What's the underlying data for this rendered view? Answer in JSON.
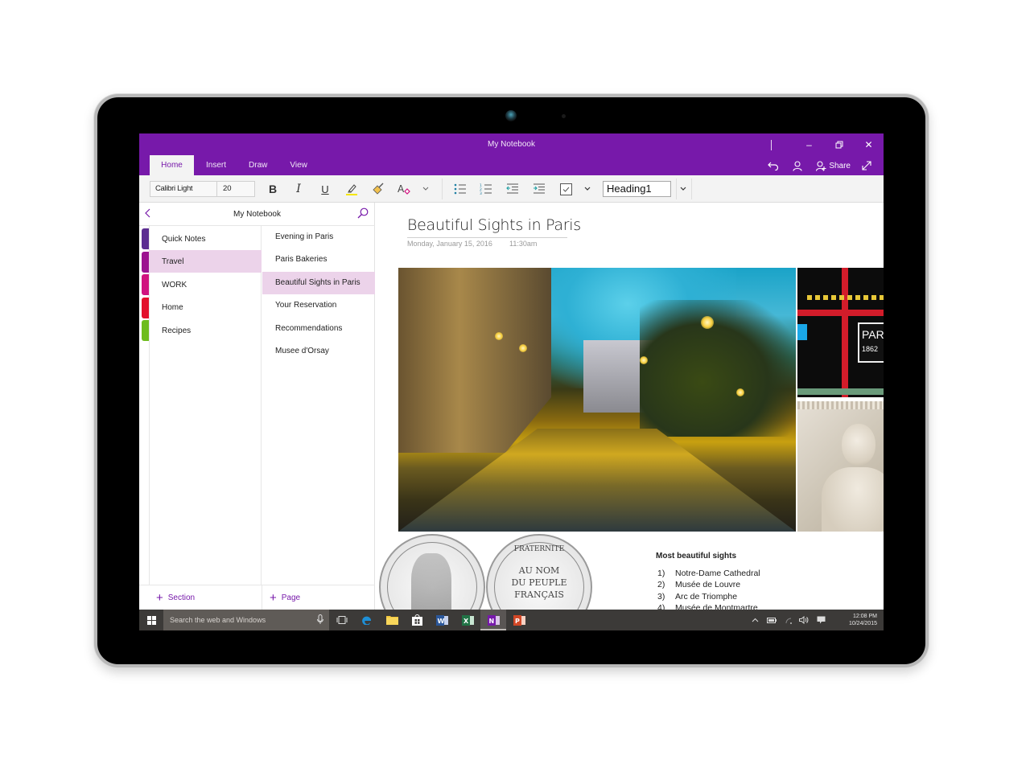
{
  "window": {
    "title": "My Notebook",
    "controls": {
      "minimize": "–",
      "restore": "❐",
      "close": "✕"
    }
  },
  "ribbon": {
    "tabs": [
      {
        "label": "Home",
        "active": true
      },
      {
        "label": "Insert",
        "active": false
      },
      {
        "label": "Draw",
        "active": false
      },
      {
        "label": "View",
        "active": false
      }
    ],
    "actions": {
      "share_label": "Share"
    },
    "font_name": "Calibri Light",
    "font_size": "20",
    "bold": "B",
    "italic": "I",
    "underline": "U",
    "style": "Heading1",
    "highlight_color": "#f5e600",
    "accent_color": "#7719aa"
  },
  "nav": {
    "title": "My Notebook",
    "sections": [
      {
        "label": "Quick Notes",
        "color": "#5c2d91",
        "active": false
      },
      {
        "label": "Travel",
        "color": "#9c1390",
        "active": true
      },
      {
        "label": "WORK",
        "color": "#d0137f",
        "active": false
      },
      {
        "label": "Home",
        "color": "#e3102c",
        "active": false
      },
      {
        "label": "Recipes",
        "color": "#6ebc1d",
        "active": false
      }
    ],
    "pages": [
      {
        "label": "Evening in Paris",
        "active": false
      },
      {
        "label": "Paris Bakeries",
        "active": false
      },
      {
        "label": "Beautiful Sights in Paris",
        "active": true
      },
      {
        "label": "Your Reservation",
        "active": false
      },
      {
        "label": "Recommendations",
        "active": false
      },
      {
        "label": "Musee d'Orsay",
        "active": false
      }
    ],
    "add_section": "Section",
    "add_page": "Page"
  },
  "page": {
    "title": "Beautiful Sights in Paris",
    "date": "Monday, January 15, 2016",
    "time": "11:30am",
    "images": {
      "glass_plaque": "PARI",
      "glass_year": "1862",
      "coin_right_lines": [
        "AU NOM",
        "DU PEUPLE",
        "FRANÇAIS"
      ],
      "coin_right_top": "FRATERNITE"
    },
    "list_title": "Most beautiful sights",
    "list": [
      {
        "num": "1)",
        "text": "Notre-Dame Cathedral"
      },
      {
        "num": "2)",
        "text": "Musée de Louvre"
      },
      {
        "num": "3)",
        "text": "Arc de Triomphe"
      },
      {
        "num": "4)",
        "text": "Musée de Montmartre"
      }
    ]
  },
  "taskbar": {
    "search_placeholder": "Search the web and Windows",
    "apps": [
      "task-view",
      "edge",
      "file-explorer",
      "store",
      "word",
      "excel",
      "onenote",
      "powerpoint"
    ],
    "time": "12:08 PM",
    "date": "10/24/2015"
  }
}
